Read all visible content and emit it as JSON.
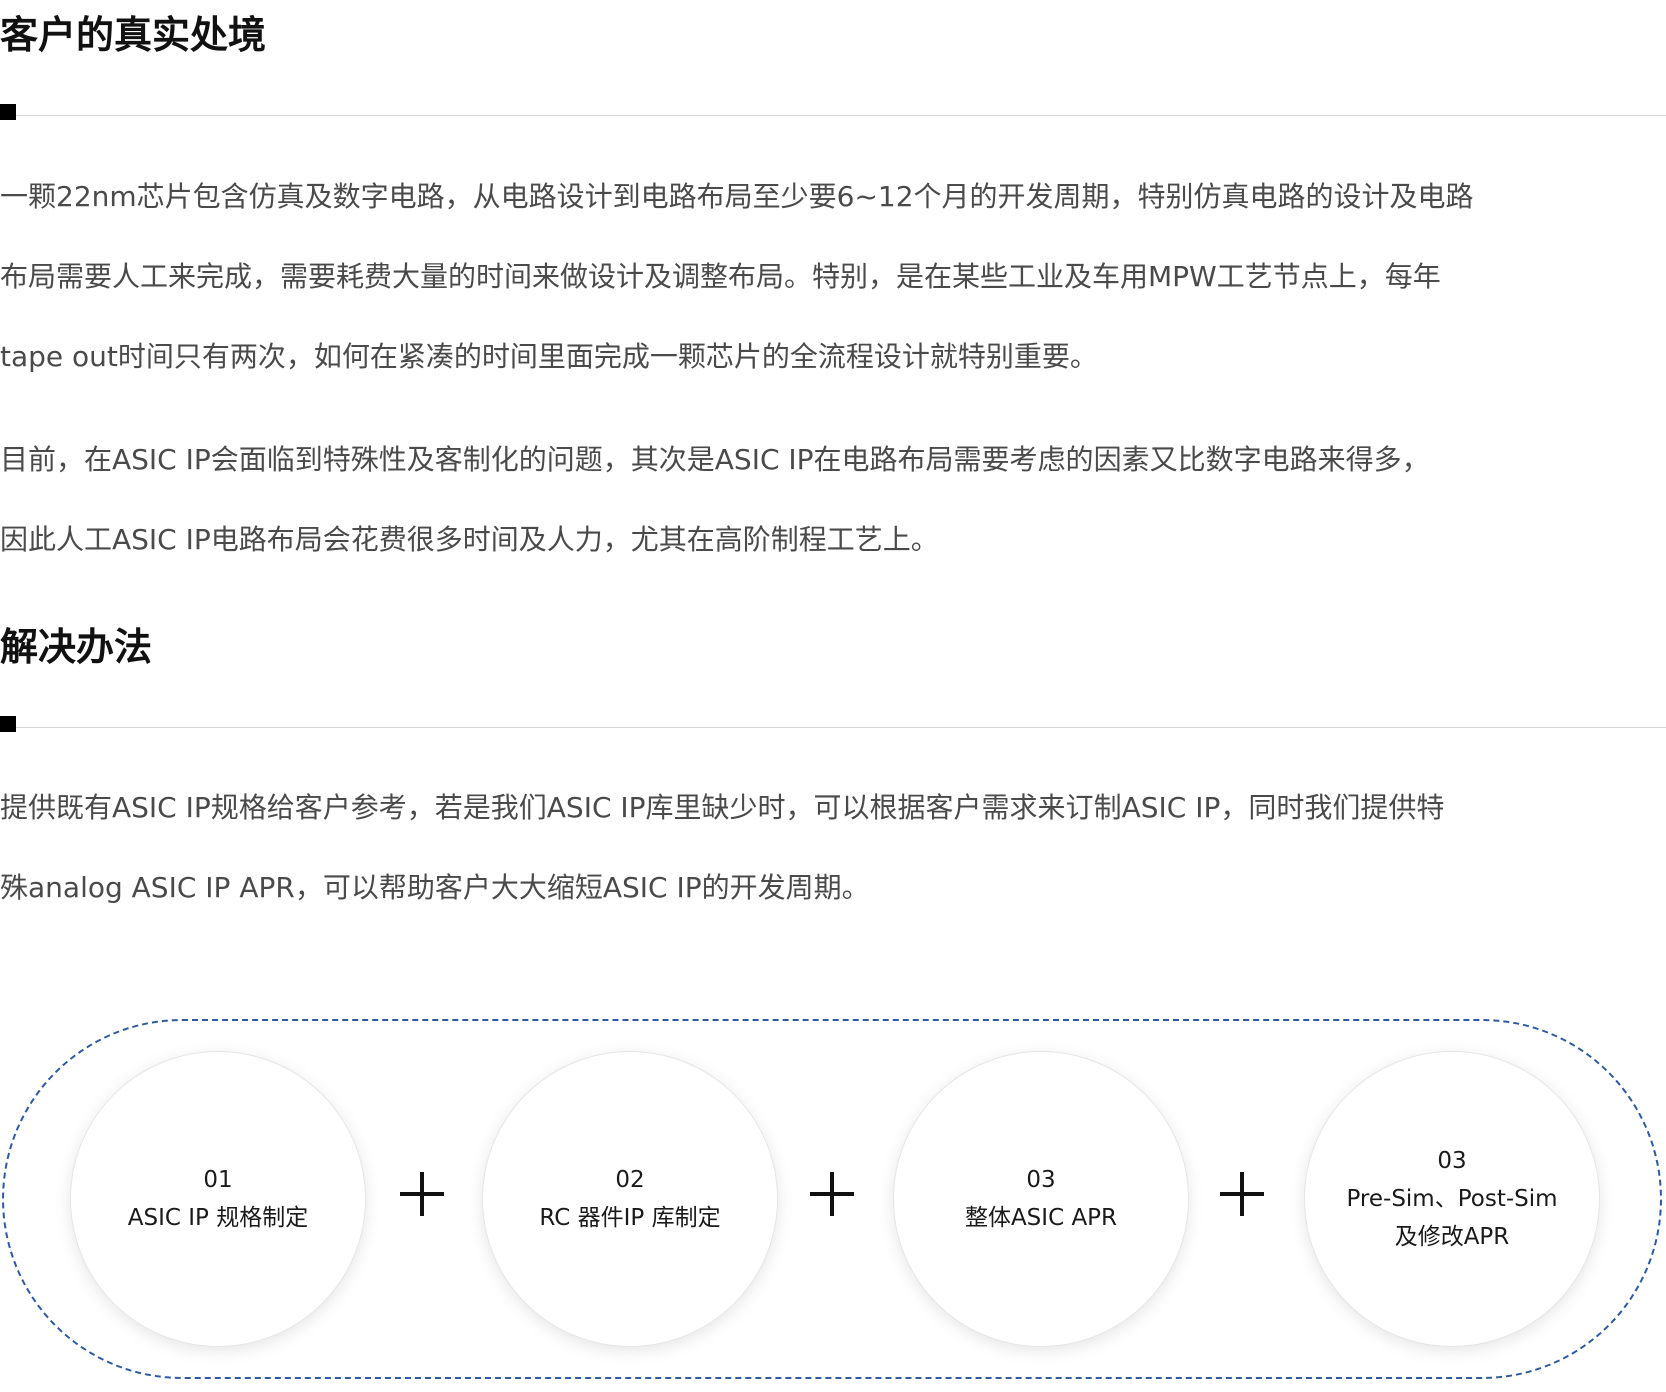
{
  "section1": {
    "title": "客户的真实处境",
    "para1": [
      "一颗22nm芯片包含仿真及数字电路，从电路设计到电路布局至少要6~12个月的开发周期，特别仿真电路的设计及电路",
      "布局需要人工来完成，需要耗费大量的时间来做设计及调整布局。特别，是在某些工业及车用MPW工艺节点上，每年",
      "tape out时间只有两次，如何在紧凑的时间里面完成一颗芯片的全流程设计就特别重要。"
    ],
    "para2": [
      "目前，在ASIC IP会面临到特殊性及客制化的问题，其次是ASIC IP在电路布局需要考虑的因素又比数字电路来得多，",
      "因此人工ASIC IP电路布局会花费很多时间及人力，尤其在高阶制程工艺上。"
    ]
  },
  "section2": {
    "title": "解决办法",
    "para1": [
      "提供既有ASIC IP规格给客户参考，若是我们ASIC IP库里缺少时，可以根据客户需求来订制ASIC IP，同时我们提供特",
      "殊analog ASIC IP APR，可以帮助客户大大缩短ASIC IP的开发周期。"
    ]
  },
  "steps": [
    {
      "lines": [
        "01",
        "ASIC IP 规格制定"
      ]
    },
    {
      "lines": [
        "02",
        "RC 器件IP 库制定"
      ]
    },
    {
      "lines": [
        "03",
        "整体ASIC APR"
      ]
    },
    {
      "lines": [
        "03",
        "Pre-Sim、Post-Sim",
        "及修改APR"
      ]
    }
  ],
  "colors": {
    "dashed_border": "#2f5aa0",
    "divider_square": "#000000",
    "body_text": "#4a4a4a"
  }
}
